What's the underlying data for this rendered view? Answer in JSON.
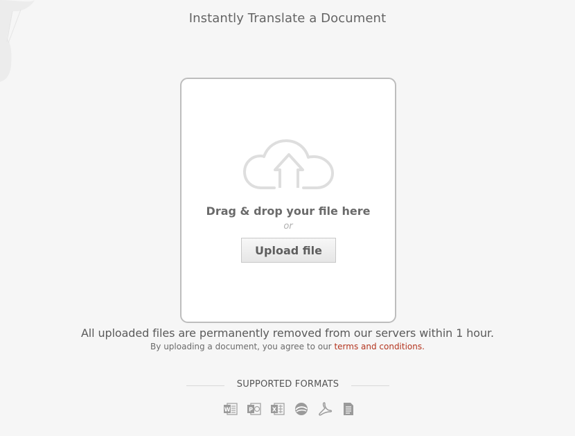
{
  "header": {
    "title": "Instantly Translate a Document"
  },
  "dropzone": {
    "drag_text": "Drag & drop your file here",
    "or_text": "or",
    "upload_label": "Upload file",
    "icon": "cloud-upload-icon"
  },
  "notice": {
    "removal": "All uploaded files are permanently removed from our servers within 1 hour.",
    "agree_prefix": "By uploading a document, you agree to our",
    "terms_link": "terms and conditions."
  },
  "formats": {
    "heading": "SUPPORTED FORMATS",
    "icons": [
      "word-icon",
      "powerpoint-icon",
      "excel-icon",
      "opendocument-icon",
      "pdf-icon",
      "text-file-icon"
    ]
  },
  "colors": {
    "background": "#f6f6f6",
    "link": "#b3341e",
    "text": "#646464",
    "icon_gray": "#9a9a9a"
  }
}
